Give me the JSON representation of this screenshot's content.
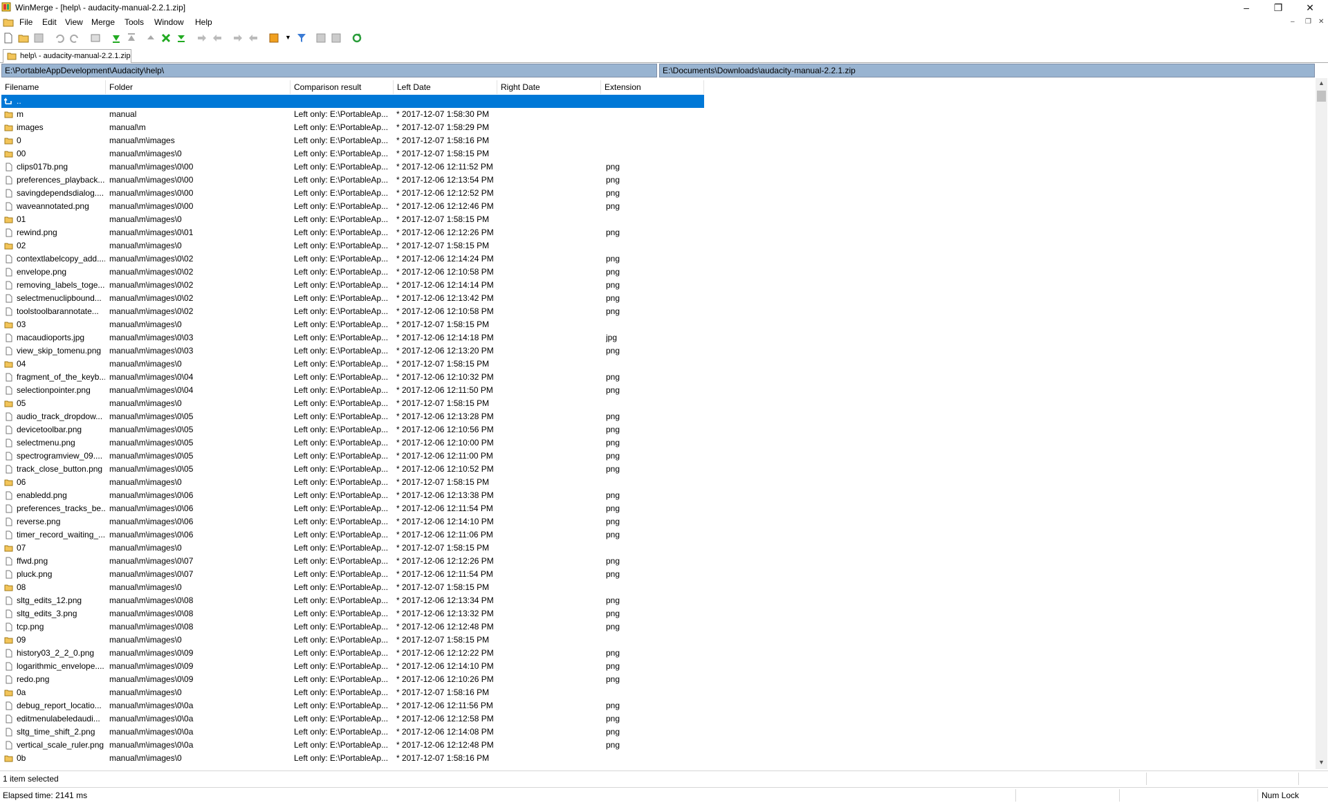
{
  "window": {
    "title": "WinMerge - [help\\ - audacity-manual-2.2.1.zip]"
  },
  "menu": [
    "File",
    "Edit",
    "View",
    "Merge",
    "Tools",
    "Window",
    "Help"
  ],
  "tab": {
    "label": "help\\ - audacity-manual-2.2.1.zip"
  },
  "paths": {
    "left": "E:\\PortableAppDevelopment\\Audacity\\help\\",
    "right": "E:\\Documents\\Downloads\\audacity-manual-2.2.1.zip"
  },
  "columns": [
    "Filename",
    "Folder",
    "Comparison result",
    "Left Date",
    "Right Date",
    "Extension"
  ],
  "rows": [
    {
      "icon": "up",
      "name": "..",
      "folder": "",
      "result": "",
      "left": "",
      "ext": ""
    },
    {
      "icon": "folder",
      "name": "m",
      "folder": "manual",
      "result": "Left only: E:\\PortableAp...",
      "left": "* 2017-12-07 1:58:30 PM",
      "ext": ""
    },
    {
      "icon": "folder",
      "name": "images",
      "folder": "manual\\m",
      "result": "Left only: E:\\PortableAp...",
      "left": "* 2017-12-07 1:58:29 PM",
      "ext": ""
    },
    {
      "icon": "folder",
      "name": "0",
      "folder": "manual\\m\\images",
      "result": "Left only: E:\\PortableAp...",
      "left": "* 2017-12-07 1:58:16 PM",
      "ext": ""
    },
    {
      "icon": "folder",
      "name": "00",
      "folder": "manual\\m\\images\\0",
      "result": "Left only: E:\\PortableAp...",
      "left": "* 2017-12-07 1:58:15 PM",
      "ext": ""
    },
    {
      "icon": "file",
      "name": "clips017b.png",
      "folder": "manual\\m\\images\\0\\00",
      "result": "Left only: E:\\PortableAp...",
      "left": "* 2017-12-06 12:11:52 PM",
      "ext": "png"
    },
    {
      "icon": "file",
      "name": "preferences_playback....",
      "folder": "manual\\m\\images\\0\\00",
      "result": "Left only: E:\\PortableAp...",
      "left": "* 2017-12-06 12:13:54 PM",
      "ext": "png"
    },
    {
      "icon": "file",
      "name": "savingdependsdialog....",
      "folder": "manual\\m\\images\\0\\00",
      "result": "Left only: E:\\PortableAp...",
      "left": "* 2017-12-06 12:12:52 PM",
      "ext": "png"
    },
    {
      "icon": "file",
      "name": "waveannotated.png",
      "folder": "manual\\m\\images\\0\\00",
      "result": "Left only: E:\\PortableAp...",
      "left": "* 2017-12-06 12:12:46 PM",
      "ext": "png"
    },
    {
      "icon": "folder",
      "name": "01",
      "folder": "manual\\m\\images\\0",
      "result": "Left only: E:\\PortableAp...",
      "left": "* 2017-12-07 1:58:15 PM",
      "ext": ""
    },
    {
      "icon": "file",
      "name": "rewind.png",
      "folder": "manual\\m\\images\\0\\01",
      "result": "Left only: E:\\PortableAp...",
      "left": "* 2017-12-06 12:12:26 PM",
      "ext": "png"
    },
    {
      "icon": "folder",
      "name": "02",
      "folder": "manual\\m\\images\\0",
      "result": "Left only: E:\\PortableAp...",
      "left": "* 2017-12-07 1:58:15 PM",
      "ext": ""
    },
    {
      "icon": "file",
      "name": "contextlabelcopy_add....",
      "folder": "manual\\m\\images\\0\\02",
      "result": "Left only: E:\\PortableAp...",
      "left": "* 2017-12-06 12:14:24 PM",
      "ext": "png"
    },
    {
      "icon": "file",
      "name": "envelope.png",
      "folder": "manual\\m\\images\\0\\02",
      "result": "Left only: E:\\PortableAp...",
      "left": "* 2017-12-06 12:10:58 PM",
      "ext": "png"
    },
    {
      "icon": "file",
      "name": "removing_labels_toge...",
      "folder": "manual\\m\\images\\0\\02",
      "result": "Left only: E:\\PortableAp...",
      "left": "* 2017-12-06 12:14:14 PM",
      "ext": "png"
    },
    {
      "icon": "file",
      "name": "selectmenuclipbound...",
      "folder": "manual\\m\\images\\0\\02",
      "result": "Left only: E:\\PortableAp...",
      "left": "* 2017-12-06 12:13:42 PM",
      "ext": "png"
    },
    {
      "icon": "file",
      "name": "toolstoolbarannotate...",
      "folder": "manual\\m\\images\\0\\02",
      "result": "Left only: E:\\PortableAp...",
      "left": "* 2017-12-06 12:10:58 PM",
      "ext": "png"
    },
    {
      "icon": "folder",
      "name": "03",
      "folder": "manual\\m\\images\\0",
      "result": "Left only: E:\\PortableAp...",
      "left": "* 2017-12-07 1:58:15 PM",
      "ext": ""
    },
    {
      "icon": "file",
      "name": "macaudioports.jpg",
      "folder": "manual\\m\\images\\0\\03",
      "result": "Left only: E:\\PortableAp...",
      "left": "* 2017-12-06 12:14:18 PM",
      "ext": "jpg"
    },
    {
      "icon": "file",
      "name": "view_skip_tomenu.png",
      "folder": "manual\\m\\images\\0\\03",
      "result": "Left only: E:\\PortableAp...",
      "left": "* 2017-12-06 12:13:20 PM",
      "ext": "png"
    },
    {
      "icon": "folder",
      "name": "04",
      "folder": "manual\\m\\images\\0",
      "result": "Left only: E:\\PortableAp...",
      "left": "* 2017-12-07 1:58:15 PM",
      "ext": ""
    },
    {
      "icon": "file",
      "name": "fragment_of_the_keyb...",
      "folder": "manual\\m\\images\\0\\04",
      "result": "Left only: E:\\PortableAp...",
      "left": "* 2017-12-06 12:10:32 PM",
      "ext": "png"
    },
    {
      "icon": "file",
      "name": "selectionpointer.png",
      "folder": "manual\\m\\images\\0\\04",
      "result": "Left only: E:\\PortableAp...",
      "left": "* 2017-12-06 12:11:50 PM",
      "ext": "png"
    },
    {
      "icon": "folder",
      "name": "05",
      "folder": "manual\\m\\images\\0",
      "result": "Left only: E:\\PortableAp...",
      "left": "* 2017-12-07 1:58:15 PM",
      "ext": ""
    },
    {
      "icon": "file",
      "name": "audio_track_dropdow...",
      "folder": "manual\\m\\images\\0\\05",
      "result": "Left only: E:\\PortableAp...",
      "left": "* 2017-12-06 12:13:28 PM",
      "ext": "png"
    },
    {
      "icon": "file",
      "name": "devicetoolbar.png",
      "folder": "manual\\m\\images\\0\\05",
      "result": "Left only: E:\\PortableAp...",
      "left": "* 2017-12-06 12:10:56 PM",
      "ext": "png"
    },
    {
      "icon": "file",
      "name": "selectmenu.png",
      "folder": "manual\\m\\images\\0\\05",
      "result": "Left only: E:\\PortableAp...",
      "left": "* 2017-12-06 12:10:00 PM",
      "ext": "png"
    },
    {
      "icon": "file",
      "name": "spectrogramview_09....",
      "folder": "manual\\m\\images\\0\\05",
      "result": "Left only: E:\\PortableAp...",
      "left": "* 2017-12-06 12:11:00 PM",
      "ext": "png"
    },
    {
      "icon": "file",
      "name": "track_close_button.png",
      "folder": "manual\\m\\images\\0\\05",
      "result": "Left only: E:\\PortableAp...",
      "left": "* 2017-12-06 12:10:52 PM",
      "ext": "png"
    },
    {
      "icon": "folder",
      "name": "06",
      "folder": "manual\\m\\images\\0",
      "result": "Left only: E:\\PortableAp...",
      "left": "* 2017-12-07 1:58:15 PM",
      "ext": ""
    },
    {
      "icon": "file",
      "name": "enabledd.png",
      "folder": "manual\\m\\images\\0\\06",
      "result": "Left only: E:\\PortableAp...",
      "left": "* 2017-12-06 12:13:38 PM",
      "ext": "png"
    },
    {
      "icon": "file",
      "name": "preferences_tracks_be...",
      "folder": "manual\\m\\images\\0\\06",
      "result": "Left only: E:\\PortableAp...",
      "left": "* 2017-12-06 12:11:54 PM",
      "ext": "png"
    },
    {
      "icon": "file",
      "name": "reverse.png",
      "folder": "manual\\m\\images\\0\\06",
      "result": "Left only: E:\\PortableAp...",
      "left": "* 2017-12-06 12:14:10 PM",
      "ext": "png"
    },
    {
      "icon": "file",
      "name": "timer_record_waiting_...",
      "folder": "manual\\m\\images\\0\\06",
      "result": "Left only: E:\\PortableAp...",
      "left": "* 2017-12-06 12:11:06 PM",
      "ext": "png"
    },
    {
      "icon": "folder",
      "name": "07",
      "folder": "manual\\m\\images\\0",
      "result": "Left only: E:\\PortableAp...",
      "left": "* 2017-12-07 1:58:15 PM",
      "ext": ""
    },
    {
      "icon": "file",
      "name": "ffwd.png",
      "folder": "manual\\m\\images\\0\\07",
      "result": "Left only: E:\\PortableAp...",
      "left": "* 2017-12-06 12:12:26 PM",
      "ext": "png"
    },
    {
      "icon": "file",
      "name": "pluck.png",
      "folder": "manual\\m\\images\\0\\07",
      "result": "Left only: E:\\PortableAp...",
      "left": "* 2017-12-06 12:11:54 PM",
      "ext": "png"
    },
    {
      "icon": "folder",
      "name": "08",
      "folder": "manual\\m\\images\\0",
      "result": "Left only: E:\\PortableAp...",
      "left": "* 2017-12-07 1:58:15 PM",
      "ext": ""
    },
    {
      "icon": "file",
      "name": "sltg_edits_12.png",
      "folder": "manual\\m\\images\\0\\08",
      "result": "Left only: E:\\PortableAp...",
      "left": "* 2017-12-06 12:13:34 PM",
      "ext": "png"
    },
    {
      "icon": "file",
      "name": "sltg_edits_3.png",
      "folder": "manual\\m\\images\\0\\08",
      "result": "Left only: E:\\PortableAp...",
      "left": "* 2017-12-06 12:13:32 PM",
      "ext": "png"
    },
    {
      "icon": "file",
      "name": "tcp.png",
      "folder": "manual\\m\\images\\0\\08",
      "result": "Left only: E:\\PortableAp...",
      "left": "* 2017-12-06 12:12:48 PM",
      "ext": "png"
    },
    {
      "icon": "folder",
      "name": "09",
      "folder": "manual\\m\\images\\0",
      "result": "Left only: E:\\PortableAp...",
      "left": "* 2017-12-07 1:58:15 PM",
      "ext": ""
    },
    {
      "icon": "file",
      "name": "history03_2_2_0.png",
      "folder": "manual\\m\\images\\0\\09",
      "result": "Left only: E:\\PortableAp...",
      "left": "* 2017-12-06 12:12:22 PM",
      "ext": "png"
    },
    {
      "icon": "file",
      "name": "logarithmic_envelope....",
      "folder": "manual\\m\\images\\0\\09",
      "result": "Left only: E:\\PortableAp...",
      "left": "* 2017-12-06 12:14:10 PM",
      "ext": "png"
    },
    {
      "icon": "file",
      "name": "redo.png",
      "folder": "manual\\m\\images\\0\\09",
      "result": "Left only: E:\\PortableAp...",
      "left": "* 2017-12-06 12:10:26 PM",
      "ext": "png"
    },
    {
      "icon": "folder",
      "name": "0a",
      "folder": "manual\\m\\images\\0",
      "result": "Left only: E:\\PortableAp...",
      "left": "* 2017-12-07 1:58:16 PM",
      "ext": ""
    },
    {
      "icon": "file",
      "name": "debug_report_locatio...",
      "folder": "manual\\m\\images\\0\\0a",
      "result": "Left only: E:\\PortableAp...",
      "left": "* 2017-12-06 12:11:56 PM",
      "ext": "png"
    },
    {
      "icon": "file",
      "name": "editmenulabeledaudi...",
      "folder": "manual\\m\\images\\0\\0a",
      "result": "Left only: E:\\PortableAp...",
      "left": "* 2017-12-06 12:12:58 PM",
      "ext": "png"
    },
    {
      "icon": "file",
      "name": "sltg_time_shift_2.png",
      "folder": "manual\\m\\images\\0\\0a",
      "result": "Left only: E:\\PortableAp...",
      "left": "* 2017-12-06 12:14:08 PM",
      "ext": "png"
    },
    {
      "icon": "file",
      "name": "vertical_scale_ruler.png",
      "folder": "manual\\m\\images\\0\\0a",
      "result": "Left only: E:\\PortableAp...",
      "left": "* 2017-12-06 12:12:48 PM",
      "ext": "png"
    },
    {
      "icon": "folder",
      "name": "0b",
      "folder": "manual\\m\\images\\0",
      "result": "Left only: E:\\PortableAp...",
      "left": "* 2017-12-07 1:58:16 PM",
      "ext": ""
    }
  ],
  "status": {
    "selection": "1 item selected",
    "elapsed": "Elapsed time: 2141 ms",
    "numlock": "Num Lock"
  },
  "colors": {
    "selection": "#0078d7",
    "pathbar": "#99b4d1"
  }
}
